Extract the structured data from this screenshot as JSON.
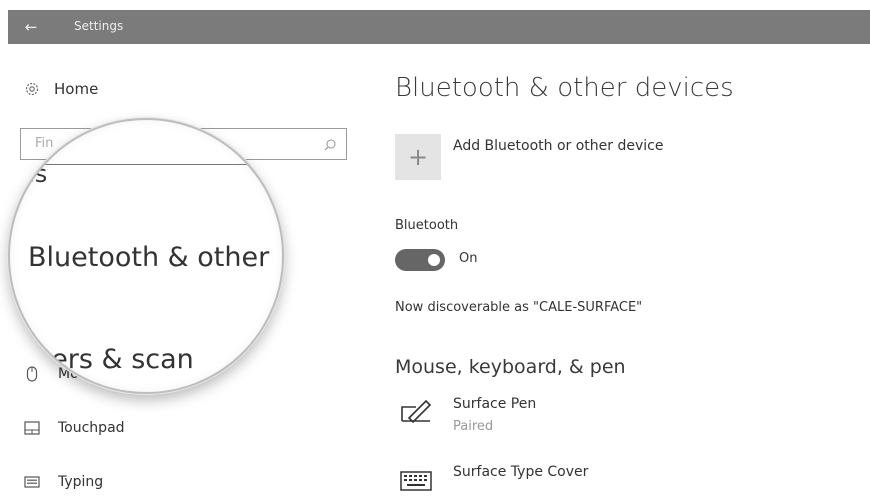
{
  "window": {
    "title": "Settings"
  },
  "nav": {
    "home": "Home",
    "search_placeholder": "Fin",
    "items": [
      {
        "label": "Mouse",
        "icon": "mouse-icon"
      },
      {
        "label": "Touchpad",
        "icon": "touchpad-icon"
      },
      {
        "label": "Typing",
        "icon": "keyboard-icon"
      }
    ]
  },
  "magnifier": {
    "line1": "es",
    "line2": "Bluetooth & other",
    "line3": "inters & scan"
  },
  "main": {
    "title": "Bluetooth & other devices",
    "add_device": "Add Bluetooth or other device",
    "bluetooth_label": "Bluetooth",
    "bluetooth_state": "On",
    "discoverable": "Now discoverable as \"CALE-SURFACE\"",
    "section_title": "Mouse, keyboard, & pen",
    "devices": [
      {
        "name": "Surface Pen",
        "status": "Paired",
        "icon": "pen-icon"
      },
      {
        "name": "Surface Type Cover",
        "status": "",
        "icon": "keyboard-icon"
      }
    ]
  }
}
